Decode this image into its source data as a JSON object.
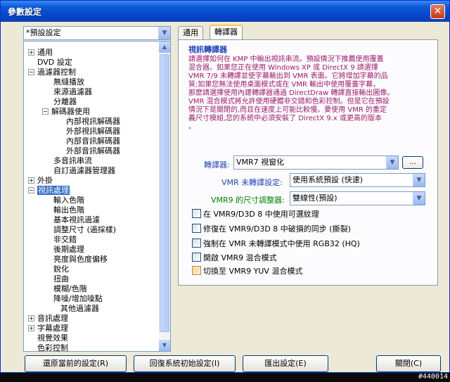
{
  "window": {
    "title": "參數設定",
    "close_label": "✕"
  },
  "preset_combo": {
    "value": "*預設設定"
  },
  "tree": {
    "items": [
      {
        "label": "通用",
        "expander": "+"
      },
      {
        "label": "DVD 設定",
        "expander": ""
      },
      {
        "label": "過濾器控制",
        "expander": "−"
      },
      {
        "label": "無縫播放",
        "expander": ""
      },
      {
        "label": "來源過濾器",
        "expander": ""
      },
      {
        "label": "分離器",
        "expander": ""
      },
      {
        "label": "解碼器使用",
        "expander": "−"
      },
      {
        "label": "內部視訊解碼器",
        "expander": ""
      },
      {
        "label": "外部視訊解碼器",
        "expander": ""
      },
      {
        "label": "內部音訊解碼器",
        "expander": ""
      },
      {
        "label": "外部音訊解碼器",
        "expander": ""
      },
      {
        "label": "多音訊串流",
        "expander": ""
      },
      {
        "label": "自訂過濾器管理器",
        "expander": ""
      },
      {
        "label": "外掛",
        "expander": "+"
      },
      {
        "label": "視訊處理",
        "expander": "−"
      },
      {
        "label": "輸入色階",
        "expander": ""
      },
      {
        "label": "輸出色階",
        "expander": ""
      },
      {
        "label": "基本視訊過濾",
        "expander": ""
      },
      {
        "label": "調整尺寸 (過採樣)",
        "expander": ""
      },
      {
        "label": "非交錯",
        "expander": ""
      },
      {
        "label": "後期處理",
        "expander": ""
      },
      {
        "label": "亮度與色度偏移",
        "expander": ""
      },
      {
        "label": "銳化",
        "expander": ""
      },
      {
        "label": "扭曲",
        "expander": ""
      },
      {
        "label": "模糊/色階",
        "expander": ""
      },
      {
        "label": "降噪/增加噪點",
        "expander": ""
      },
      {
        "label": "其他過濾器",
        "expander": ""
      },
      {
        "label": "音訊處理",
        "expander": "+"
      },
      {
        "label": "字幕處理",
        "expander": "+"
      },
      {
        "label": "視覺效果",
        "expander": ""
      },
      {
        "label": "色彩控制",
        "expander": ""
      }
    ]
  },
  "tabs": [
    {
      "label": "通用"
    },
    {
      "label": "轉譯器"
    }
  ],
  "renderer_panel": {
    "title": "視訊轉譯器",
    "description_lines": [
      "請選擇如何在 KMP 中輸出視訊串流。預設情況下推薦使用覆蓋",
      "混合器。如果您正在使用 Windows XP 或 DirectX 9 請選擇",
      "VMR 7/9 未轉譯並使字幕輸出到 VMR 表面。它將增加字幕的品",
      "質;如果您無法使用桌面模式或在 VMR 輸出中使用覆蓋字幕，",
      "那麼請選擇使用內建轉譯器通過 DirectDraw 轉譯直接輸出圖像。",
      "VMR 混合模式將允許使用硬體非交錯和色彩控制。但是它在預設",
      "情況下是關閉的,而且在速度上可能比較慢。要使用 VMR 的重定",
      "義尺寸模組,您的系統中必須安裝了 DirectX 9.x 或更高的版本",
      "。"
    ],
    "renderer_label": "轉譯器:",
    "renderer_value": "VMR7 視窗化",
    "renderer_button": "...",
    "vmr_unrendered_label": "VMR 未轉譯設定:",
    "vmr_unrendered_value": "使用系統預設 (快速)",
    "vmr9_resizer_label": "VMR9 的尺寸調整器:",
    "vmr9_resizer_value": "雙線性(預設)",
    "checkboxes": [
      "在 VMR9/D3D 8 中使用可選紋理",
      "修復在 VMR9/D3D 8 中破損的同步 (撕裂)",
      "強制在 VMR 未轉譯模式中使用 RGB32 (HQ)",
      "開啟 VMR9 混合模式",
      "切換至 VMR9 YUV 混合模式"
    ]
  },
  "buttons": {
    "restore": "還原當前的設定(R)",
    "reset": "回復系統初始設定(I)",
    "export": "匯出設定(E)",
    "close": "關閉(C)"
  },
  "watermark": "#440014",
  "colors": {
    "title_blue": "#1f45b4",
    "description_purple": "#9d1b6b",
    "label_green": "#008000",
    "selection_blue": "#316ac5"
  }
}
